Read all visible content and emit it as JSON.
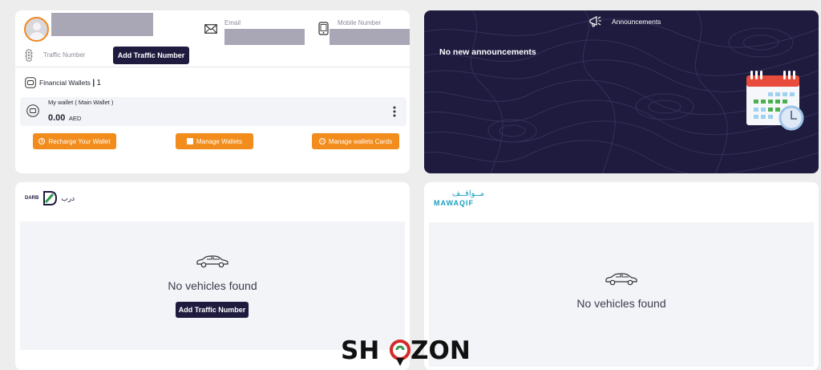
{
  "profile": {
    "email_label": "Email",
    "mobile_label": "Mobile Number",
    "traffic_label": "Traffic Number",
    "add_traffic_button": "Add Traffic Number",
    "wallets_title": "Financial Wallets",
    "wallets_count": "1",
    "wallet_name": "My wallet ( Main Wallet )",
    "wallet_amount": "0.00",
    "wallet_currency": "AED",
    "recharge_button": "Recharge Your Wallet",
    "manage_wallets_button": "Manage Wallets",
    "manage_cards_button": "Manage wallets Cards"
  },
  "announcements": {
    "title": "Announcements",
    "message": "No new announcements"
  },
  "darb": {
    "logo_text": "DARB",
    "logo_arabic": "درب",
    "empty_text": "No vehicles found",
    "add_button": "Add Traffic Number"
  },
  "mawaqif": {
    "logo_arabic": "مــواقــف",
    "logo_text": "MAWAQIF",
    "empty_text": "No vehicles found"
  },
  "watermark": {
    "text": "SHOZON"
  },
  "colors": {
    "navy": "#1e1b3f",
    "orange": "#f28c1c",
    "teal": "#1a9fc0",
    "darb_green": "#2e9a4a",
    "background": "#ededed"
  },
  "icons": [
    "avatar-icon",
    "envelope-icon",
    "phone-icon",
    "traffic-light-icon",
    "wallet-icon",
    "kebab-menu-icon",
    "megaphone-icon",
    "calendar-clock-icon",
    "car-icon"
  ]
}
